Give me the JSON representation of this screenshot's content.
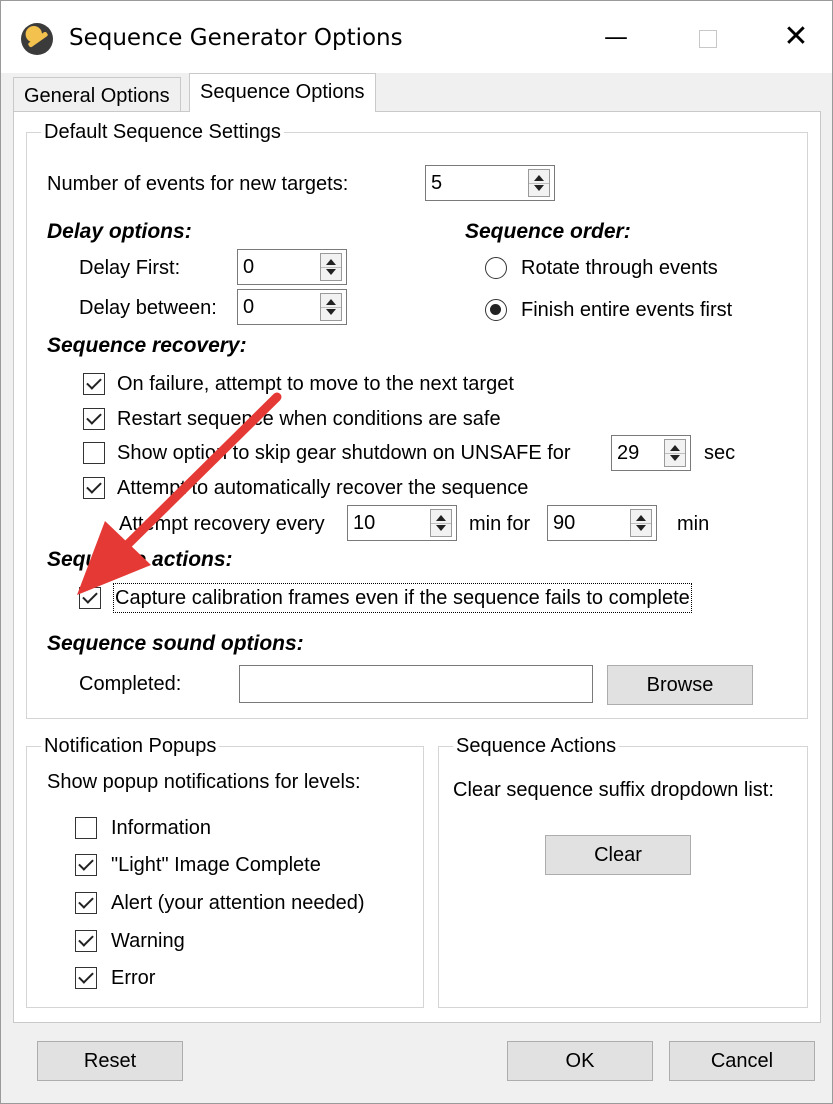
{
  "window": {
    "title": "Sequence Generator Options"
  },
  "tabs": [
    {
      "label": "General Options"
    },
    {
      "label": "Sequence Options"
    }
  ],
  "default_settings": {
    "title": "Default Sequence Settings",
    "events_label": "Number of events for new targets:",
    "events_value": "5",
    "delay": {
      "heading": "Delay options:",
      "first_label": "Delay First:",
      "first_value": "0",
      "between_label": "Delay between:",
      "between_value": "0"
    },
    "order": {
      "heading": "Sequence order:",
      "rotate_label": "Rotate through events",
      "rotate_checked": false,
      "finish_label": "Finish entire events first",
      "finish_checked": true
    },
    "recovery": {
      "heading": "Sequence recovery:",
      "on_failure_label": "On failure, attempt to move to the next target",
      "on_failure_checked": true,
      "restart_label": "Restart sequence when conditions are safe",
      "restart_checked": true,
      "skip_gear_label": "Show option to skip gear shutdown on UNSAFE for",
      "skip_gear_checked": false,
      "skip_gear_value": "29",
      "skip_gear_unit": "sec",
      "auto_recover_label": "Attempt to automatically recover the sequence",
      "auto_recover_checked": true,
      "attempt_every_label": "Attempt recovery every",
      "attempt_every_value": "10",
      "min_for_label": "min for",
      "min_for_value": "90",
      "min_label": "min"
    },
    "actions": {
      "heading": "Sequence actions:",
      "capture_label": "Capture calibration frames even if the sequence fails to complete",
      "capture_checked": true
    },
    "sound": {
      "heading": "Sequence sound options:",
      "completed_label": "Completed:",
      "completed_value": "",
      "browse_label": "Browse"
    }
  },
  "notifications": {
    "title": "Notification Popups",
    "description": "Show popup notifications for levels:",
    "levels": [
      {
        "label": "Information",
        "checked": false
      },
      {
        "label": "\"Light\" Image Complete",
        "checked": true
      },
      {
        "label": "Alert (your attention needed)",
        "checked": true
      },
      {
        "label": "Warning",
        "checked": true
      },
      {
        "label": "Error",
        "checked": true
      }
    ]
  },
  "sequence_actions": {
    "title": "Sequence Actions",
    "description": "Clear sequence suffix dropdown list:",
    "clear_label": "Clear"
  },
  "footer": {
    "reset_label": "Reset",
    "ok_label": "OK",
    "cancel_label": "Cancel"
  },
  "colors": {
    "annotation_arrow": "#e53935",
    "window_bg": "#f0f0f0",
    "panel_bg": "#ffffff"
  }
}
